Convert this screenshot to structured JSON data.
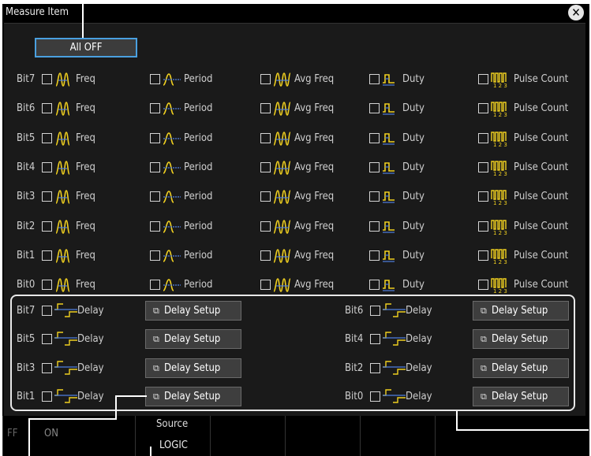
{
  "dialog": {
    "title": "Measure Item",
    "close_icon": "close-icon",
    "all_off_label": "All OFF"
  },
  "measure_columns": [
    "Freq",
    "Period",
    "Avg Freq",
    "Duty",
    "Pulse Count"
  ],
  "bits": [
    "Bit7",
    "Bit6",
    "Bit5",
    "Bit4",
    "Bit3",
    "Bit2",
    "Bit1",
    "Bit0"
  ],
  "delay": {
    "label": "Delay",
    "setup_label": "Delay Setup",
    "rows": [
      [
        "Bit7",
        "Bit6"
      ],
      [
        "Bit5",
        "Bit4"
      ],
      [
        "Bit3",
        "Bit2"
      ],
      [
        "Bit1",
        "Bit0"
      ]
    ]
  },
  "softkeys": {
    "off": "FF",
    "on": "ON",
    "source_label": "Source",
    "source_value": "LOGIC"
  },
  "colors": {
    "accent_border": "#4aa0e0",
    "icon_yellow": "#f0d020",
    "icon_blue": "#4f7fe0"
  }
}
